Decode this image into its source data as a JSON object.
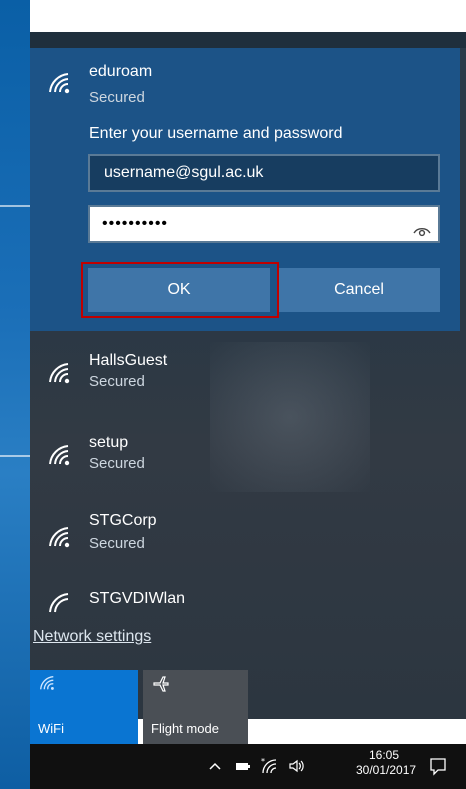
{
  "selected_network": {
    "name": "eduroam",
    "status": "Secured",
    "prompt": "Enter your username and password",
    "username_value": "username@sgul.ac.uk",
    "password_mask": "••••••••••",
    "ok_label": "OK",
    "cancel_label": "Cancel"
  },
  "networks": [
    {
      "name": "HallsGuest",
      "status": "Secured"
    },
    {
      "name": "setup",
      "status": "Secured"
    },
    {
      "name": "STGCorp",
      "status": "Secured"
    },
    {
      "name": "STGVDIWlan",
      "status": ""
    }
  ],
  "network_settings_link": "Network settings",
  "quick_actions": [
    {
      "label": "WiFi",
      "icon": "wifi-icon",
      "active": true
    },
    {
      "label": "Flight mode",
      "icon": "airplane-icon",
      "active": false
    }
  ],
  "taskbar": {
    "time": "16:05",
    "date": "30/01/2017"
  },
  "colors": {
    "selected_bg": "#1c5387",
    "button_bg": "#3f75a8",
    "wifi_tile": "#0a75d2",
    "highlight_outline": "#c00000"
  }
}
